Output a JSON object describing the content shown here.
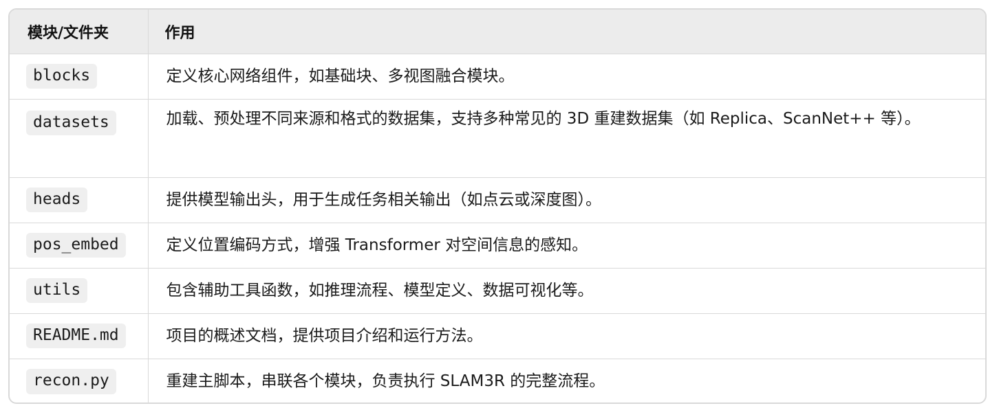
{
  "table": {
    "headers": [
      "模块/文件夹",
      "作用"
    ],
    "rows": [
      {
        "name": "blocks",
        "desc": "定义核心网络组件，如基础块、多视图融合模块。"
      },
      {
        "name": "datasets",
        "desc": "加载、预处理不同来源和格式的数据集，支持多种常见的 3D 重建数据集（如 Replica、ScanNet++ 等）。"
      },
      {
        "name": "heads",
        "desc": "提供模型输出头，用于生成任务相关输出（如点云或深度图）。"
      },
      {
        "name": "pos_embed",
        "desc": "定义位置编码方式，增强 Transformer 对空间信息的感知。"
      },
      {
        "name": "utils",
        "desc": "包含辅助工具函数，如推理流程、模型定义、数据可视化等。"
      },
      {
        "name": "README.md",
        "desc": "项目的概述文档，提供项目介绍和运行方法。"
      },
      {
        "name": "recon.py",
        "desc": "重建主脚本，串联各个模块，负责执行 SLAM3R 的完整流程。"
      }
    ]
  },
  "colors": {
    "header_bg": "#ececec",
    "border": "#d9d9d9",
    "code_bg": "#efefef",
    "text": "#1a1a1a"
  }
}
